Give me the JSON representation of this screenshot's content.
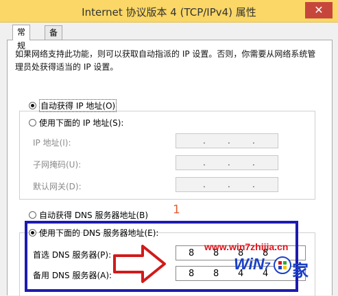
{
  "window": {
    "title": "Internet 协议版本 4 (TCP/IPv4) 属性",
    "close_glyph": "✕"
  },
  "tabs": [
    {
      "label": "常规",
      "active": true
    },
    {
      "label": "备用配置",
      "active": false
    }
  ],
  "description": "如果网络支持此功能，则可以获取自动指派的 IP 设置。否则，你需要从网络系统管理员处获得适当的 IP 设置。",
  "ip_section": {
    "auto_label": "自动获得 IP 地址(O)",
    "manual_label": "使用下面的 IP 地址(S):",
    "selected": "auto",
    "fields": [
      {
        "label": "IP 地址(I):"
      },
      {
        "label": "子网掩码(U):"
      },
      {
        "label": "默认网关(D):"
      }
    ]
  },
  "dns_section": {
    "auto_label": "自动获得 DNS 服务器地址(B)",
    "manual_label": "使用下面的 DNS 服务器地址(E):",
    "selected": "manual",
    "preferred": {
      "label": "首选 DNS 服务器(P):",
      "octets": [
        "8",
        "8",
        "8",
        "8"
      ]
    },
    "alternate": {
      "label": "备用 DNS 服务器(A):",
      "octets": [
        "8",
        "8",
        "4",
        "4"
      ]
    }
  },
  "annotation": {
    "step_number": "1",
    "frame_color": "#1d1ab0",
    "arrow_color": "#d11a1a"
  },
  "watermark": {
    "url": "www.win7zhijia.cn",
    "logo_win": "WiN",
    "logo_7": "7",
    "logo_char": "家"
  },
  "colors": {
    "titlebar": "#fad766",
    "close": "#c7463c"
  }
}
